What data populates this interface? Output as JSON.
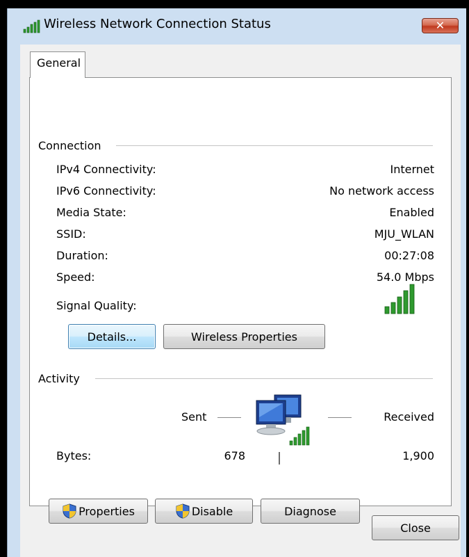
{
  "window": {
    "title": "Wireless Network Connection Status",
    "close_glyph": "✕"
  },
  "tabs": [
    {
      "label": "General"
    }
  ],
  "connection": {
    "label": "Connection",
    "rows": [
      {
        "label": "IPv4 Connectivity:",
        "value": "Internet"
      },
      {
        "label": "IPv6 Connectivity:",
        "value": "No network access"
      },
      {
        "label": "Media State:",
        "value": "Enabled"
      },
      {
        "label": "SSID:",
        "value": "MJU_WLAN"
      },
      {
        "label": "Duration:",
        "value": "00:27:08"
      },
      {
        "label": "Speed:",
        "value": "54.0 Mbps"
      }
    ],
    "signal_label": "Signal Quality:",
    "signal_bars": 5,
    "details_button": "Details...",
    "wireless_properties_button": "Wireless Properties"
  },
  "activity": {
    "label": "Activity",
    "sent_label": "Sent",
    "received_label": "Received",
    "bytes_label": "Bytes:",
    "bytes_sent": "678",
    "bytes_received": "1,900"
  },
  "actions": {
    "properties": "Properties",
    "disable": "Disable",
    "diagnose": "Diagnose"
  },
  "footer": {
    "close": "Close"
  },
  "icons": {
    "title": "wireless-signal-icon",
    "signal": "signal-bars-icon",
    "activity": "network-computers-icon",
    "shield": "uac-shield-icon"
  },
  "colors": {
    "signal_green": "#2f9a2f",
    "close_red": "#c0391f",
    "window_frame": "#cddff2"
  }
}
